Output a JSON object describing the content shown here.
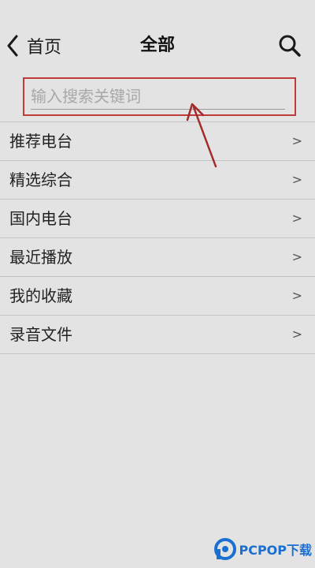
{
  "header": {
    "back_label": "首页",
    "title": "全部"
  },
  "search": {
    "placeholder": "输入搜索关键词",
    "value": ""
  },
  "list": {
    "chevron": ">",
    "items": [
      {
        "label": "推荐电台"
      },
      {
        "label": "精选综合"
      },
      {
        "label": "国内电台"
      },
      {
        "label": "最近播放"
      },
      {
        "label": "我的收藏"
      },
      {
        "label": "录音文件"
      }
    ]
  },
  "watermark": {
    "text": "PCPOP下载",
    "color": "#1b6fd1"
  },
  "colors": {
    "background": "#e3e3e3",
    "highlight": "#c0393b",
    "text": "#222222"
  }
}
